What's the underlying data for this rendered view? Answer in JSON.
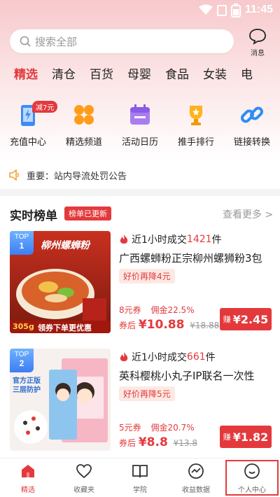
{
  "status_bar": {
    "time": "11:45"
  },
  "search": {
    "placeholder": "搜索全部"
  },
  "message": {
    "label": "消息"
  },
  "tabs": [
    {
      "label": "精选",
      "active": true
    },
    {
      "label": "清仓"
    },
    {
      "label": "百货"
    },
    {
      "label": "母婴"
    },
    {
      "label": "食品"
    },
    {
      "label": "女装"
    },
    {
      "label": "电"
    }
  ],
  "quick": [
    {
      "label": "充值中心",
      "icon": "phone-charge-icon",
      "badge": "减7元"
    },
    {
      "label": "精选频道",
      "icon": "grid-flower-icon"
    },
    {
      "label": "活动日历",
      "icon": "calendar-icon"
    },
    {
      "label": "推手排行",
      "icon": "trophy-icon"
    },
    {
      "label": "链接转换",
      "icon": "link-icon"
    }
  ],
  "notice": {
    "text": "重要：站内导流处罚公告"
  },
  "rank": {
    "title": "实时榜单",
    "badge": "榜单已更新",
    "more": "查看更多 >"
  },
  "products": [
    {
      "rank_label": "TOP",
      "rank_num": "1",
      "sales_prefix": "近1小时成交",
      "sales_num": "1421",
      "sales_suffix": "件",
      "title": "广西螺蛳粉正宗柳州螺狮粉3包",
      "cut": "好价再降4元",
      "coupon": "8元券",
      "commission": "佣金22.5%",
      "after_label": "券后",
      "price": "¥10.88",
      "orig": "¥18.88",
      "earn_label": "赚",
      "earn_value": "¥2.45",
      "img_text": "柳州螺蛳粉",
      "img_price": "305g",
      "img_banner": "领券下单更优惠"
    },
    {
      "rank_label": "TOP",
      "rank_num": "2",
      "sales_prefix": "近1小时成交",
      "sales_num": "661",
      "sales_suffix": "件",
      "title": "英科樱桃小丸子IP联名一次性",
      "cut": "好价再降5元",
      "coupon": "5元券",
      "commission": "佣金20.7%",
      "after_label": "券后",
      "price": "¥8.8",
      "orig": "¥13.8",
      "earn_label": "赚",
      "earn_value": "¥1.82",
      "img_text": "官方正版 三层防护"
    }
  ],
  "bottom_nav": [
    {
      "label": "精选",
      "icon": "home-icon",
      "active": true
    },
    {
      "label": "收藏夹",
      "icon": "heart-icon"
    },
    {
      "label": "学院",
      "icon": "book-icon"
    },
    {
      "label": "收益数据",
      "icon": "chart-circle-icon"
    },
    {
      "label": "个人中心",
      "icon": "smile-icon",
      "highlight": true
    }
  ],
  "colors": {
    "accent": "#e4393c",
    "bg_top": "#f7c9cc",
    "link_blue": "#3d7df5"
  }
}
